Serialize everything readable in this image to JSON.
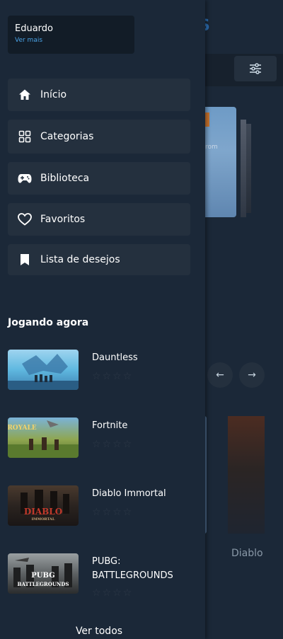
{
  "background": {
    "logo_text": "RS",
    "card_text": "rom",
    "tile_label": "Diablo",
    "prev_arrow": "←",
    "next_arrow": "→"
  },
  "user": {
    "name": "Eduardo",
    "more_link": "Ver mais"
  },
  "nav": [
    {
      "label": "Início",
      "icon": "home-icon"
    },
    {
      "label": "Categorias",
      "icon": "grid-icon"
    },
    {
      "label": "Biblioteca",
      "icon": "gamepad-icon"
    },
    {
      "label": "Favoritos",
      "icon": "heart-icon"
    },
    {
      "label": "Lista de desejos",
      "icon": "bookmark-icon"
    }
  ],
  "playing_now": {
    "title": "Jogando agora",
    "games": [
      {
        "title": "Dauntless",
        "stars": "☆☆☆☆",
        "rating": 0
      },
      {
        "title": "Fortnite",
        "stars": "☆☆☆☆",
        "rating": 0,
        "thumb_text": "ROYALE"
      },
      {
        "title": "Diablo Immortal",
        "stars": "☆☆☆☆",
        "rating": 0,
        "thumb_text": "DIABLO",
        "thumb_subtext": "IMMORTAL"
      },
      {
        "title": "PUBG: BATTLEGROUNDS",
        "stars": "☆☆☆☆",
        "rating": 0,
        "thumb_text": "PUBG",
        "thumb_subtext": "BATTLEGROUNDS"
      }
    ],
    "see_all": "Ver todos"
  },
  "colors": {
    "background": "#1b2838",
    "nav_item": "#24303e",
    "user_card": "#121c27",
    "link": "#4aa3e6",
    "logo": "#2c6db0"
  }
}
